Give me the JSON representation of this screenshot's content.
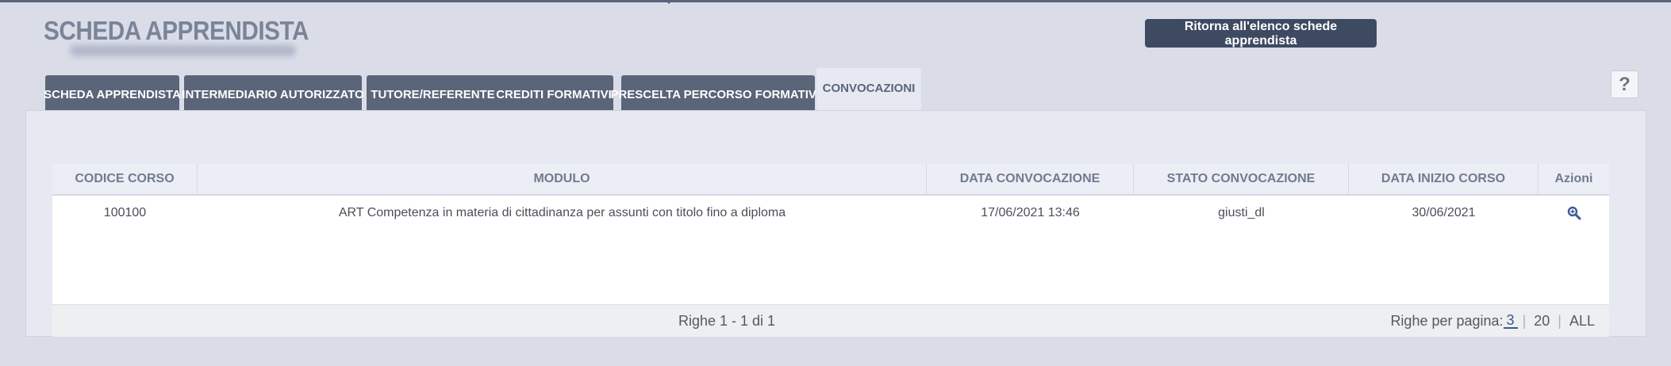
{
  "header": {
    "title": "SCHEDA APPRENDISTA",
    "back_label": "Ritorna all'elenco schede apprendista",
    "help_label": "?"
  },
  "tabs": [
    {
      "label": "SCHEDA APPRENDISTA",
      "active": false
    },
    {
      "label": "INTERMEDIARIO AUTORIZZATO",
      "active": false
    },
    {
      "label": "TUTORE/REFERENTE",
      "active": false
    },
    {
      "label": "CREDITI FORMATIVI",
      "active": false
    },
    {
      "label": "PRESCELTA PERCORSO FORMATIVO",
      "active": false
    },
    {
      "label": "CONVOCAZIONI",
      "active": true
    }
  ],
  "table": {
    "columns": [
      "CODICE CORSO",
      "MODULO",
      "DATA CONVOCAZIONE",
      "STATO CONVOCAZIONE",
      "DATA INIZIO CORSO",
      "Azioni"
    ],
    "rows": [
      {
        "codice_corso": "100100",
        "modulo": "ART Competenza in materia di cittadinanza per assunti con titolo fino a diploma",
        "data_convocazione": "17/06/2021 13:46",
        "stato_convocazione": "giusti_dl",
        "data_inizio_corso": "30/06/2021",
        "action_icon": "zoom-icon"
      }
    ]
  },
  "footer": {
    "range_info": "Righe 1 - 1 di 1",
    "per_page_label": "Righe per pagina:",
    "options": [
      "3",
      "20",
      "ALL"
    ],
    "selected_option": "3"
  },
  "colors": {
    "background": "#dadde8",
    "tab_inactive": "#5b6579",
    "button_dark": "#3d4a62",
    "title_gray": "#7a8499"
  }
}
